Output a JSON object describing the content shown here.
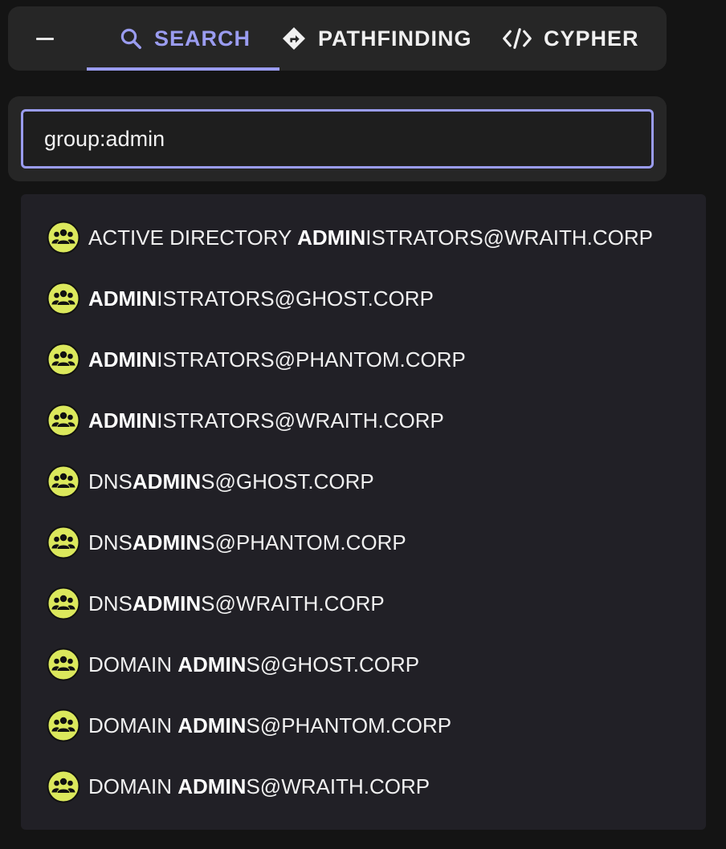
{
  "tabs": [
    {
      "label": "SEARCH",
      "icon": "search-icon",
      "active": true
    },
    {
      "label": "PATHFINDING",
      "icon": "directions-icon",
      "active": false
    },
    {
      "label": "CYPHER",
      "icon": "code-icon",
      "active": false
    }
  ],
  "search": {
    "value": "group:admin",
    "placeholder": ""
  },
  "results": [
    {
      "pre": "ACTIVE DIRECTORY ",
      "match": "ADMIN",
      "post": "ISTRATORS@WRAITH.CORP",
      "icon": "group-icon"
    },
    {
      "pre": "",
      "match": "ADMIN",
      "post": "ISTRATORS@GHOST.CORP",
      "icon": "group-icon"
    },
    {
      "pre": "",
      "match": "ADMIN",
      "post": "ISTRATORS@PHANTOM.CORP",
      "icon": "group-icon"
    },
    {
      "pre": "",
      "match": "ADMIN",
      "post": "ISTRATORS@WRAITH.CORP",
      "icon": "group-icon"
    },
    {
      "pre": "DNS",
      "match": "ADMIN",
      "post": "S@GHOST.CORP",
      "icon": "group-icon"
    },
    {
      "pre": "DNS",
      "match": "ADMIN",
      "post": "S@PHANTOM.CORP",
      "icon": "group-icon"
    },
    {
      "pre": "DNS",
      "match": "ADMIN",
      "post": "S@WRAITH.CORP",
      "icon": "group-icon"
    },
    {
      "pre": "DOMAIN ",
      "match": "ADMIN",
      "post": "S@GHOST.CORP",
      "icon": "group-icon"
    },
    {
      "pre": "DOMAIN ",
      "match": "ADMIN",
      "post": "S@PHANTOM.CORP",
      "icon": "group-icon"
    },
    {
      "pre": "DOMAIN ",
      "match": "ADMIN",
      "post": "S@WRAITH.CORP",
      "icon": "group-icon"
    }
  ],
  "colors": {
    "accent": "#9a9cf0",
    "group_icon_fill": "#dbe85c",
    "panel_bg": "#262626",
    "dropdown_bg": "#212026"
  }
}
